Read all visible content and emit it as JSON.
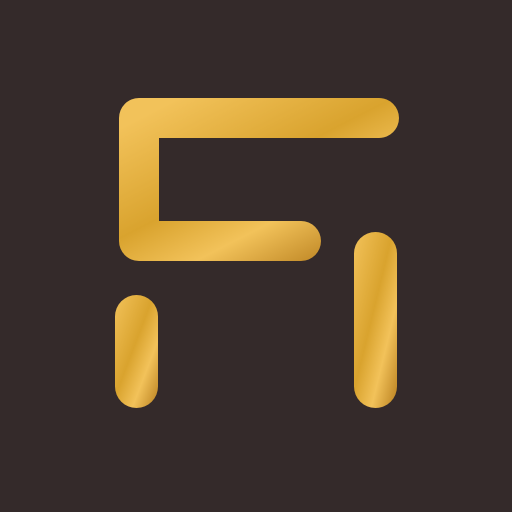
{
  "icon": {
    "name": "gold-monogram-logo",
    "background_color": "#342a2a",
    "gold_light": "#f2c25a",
    "gold_mid": "#d9a32e",
    "gold_dark": "#b9801f"
  }
}
